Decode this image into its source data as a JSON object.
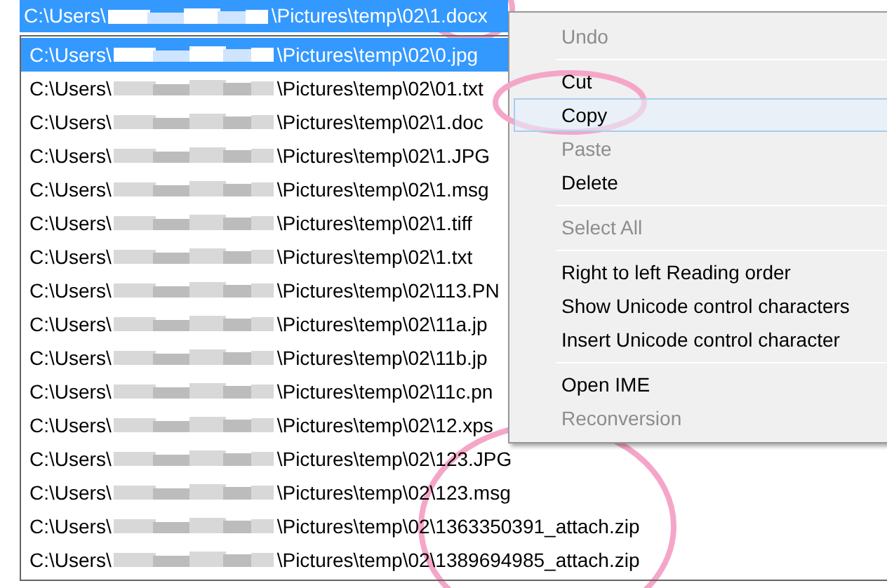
{
  "path_field": {
    "prefix": "C:\\Users\\",
    "suffix": "\\Pictures\\temp\\02\\1.docx"
  },
  "list": [
    {
      "prefix": "C:\\Users\\",
      "suffix": "\\Pictures\\temp\\02\\0.jpg",
      "selected": true
    },
    {
      "prefix": "C:\\Users\\",
      "suffix": "\\Pictures\\temp\\02\\01.txt",
      "selected": false
    },
    {
      "prefix": "C:\\Users\\",
      "suffix": "\\Pictures\\temp\\02\\1.doc",
      "selected": false
    },
    {
      "prefix": "C:\\Users\\",
      "suffix": "\\Pictures\\temp\\02\\1.JPG",
      "selected": false
    },
    {
      "prefix": "C:\\Users\\",
      "suffix": "\\Pictures\\temp\\02\\1.msg",
      "selected": false
    },
    {
      "prefix": "C:\\Users\\",
      "suffix": "\\Pictures\\temp\\02\\1.tiff",
      "selected": false
    },
    {
      "prefix": "C:\\Users\\",
      "suffix": "\\Pictures\\temp\\02\\1.txt",
      "selected": false
    },
    {
      "prefix": "C:\\Users\\",
      "suffix": "\\Pictures\\temp\\02\\113.PN",
      "selected": false
    },
    {
      "prefix": "C:\\Users\\",
      "suffix": "\\Pictures\\temp\\02\\11a.jp",
      "selected": false
    },
    {
      "prefix": "C:\\Users\\",
      "suffix": "\\Pictures\\temp\\02\\11b.jp",
      "selected": false
    },
    {
      "prefix": "C:\\Users\\",
      "suffix": "\\Pictures\\temp\\02\\11c.pn",
      "selected": false
    },
    {
      "prefix": "C:\\Users\\",
      "suffix": "\\Pictures\\temp\\02\\12.xps",
      "selected": false
    },
    {
      "prefix": "C:\\Users\\",
      "suffix": "\\Pictures\\temp\\02\\123.JPG",
      "selected": false
    },
    {
      "prefix": "C:\\Users\\",
      "suffix": "\\Pictures\\temp\\02\\123.msg",
      "selected": false
    },
    {
      "prefix": "C:\\Users\\",
      "suffix": "\\Pictures\\temp\\02\\1363350391_attach.zip",
      "selected": false
    },
    {
      "prefix": "C:\\Users\\",
      "suffix": "\\Pictures\\temp\\02\\1389694985_attach.zip",
      "selected": false
    }
  ],
  "context_menu": [
    {
      "kind": "item",
      "label": "Undo",
      "disabled": true,
      "selected": false
    },
    {
      "kind": "separator"
    },
    {
      "kind": "item",
      "label": "Cut",
      "disabled": false,
      "selected": false
    },
    {
      "kind": "item",
      "label": "Copy",
      "disabled": false,
      "selected": true
    },
    {
      "kind": "item",
      "label": "Paste",
      "disabled": true,
      "selected": false
    },
    {
      "kind": "item",
      "label": "Delete",
      "disabled": false,
      "selected": false
    },
    {
      "kind": "separator"
    },
    {
      "kind": "item",
      "label": "Select All",
      "disabled": true,
      "selected": false
    },
    {
      "kind": "separator"
    },
    {
      "kind": "item",
      "label": "Right to left Reading order",
      "disabled": false,
      "selected": false
    },
    {
      "kind": "item",
      "label": "Show Unicode control characters",
      "disabled": false,
      "selected": false
    },
    {
      "kind": "item",
      "label": "Insert Unicode control character",
      "disabled": false,
      "selected": false
    },
    {
      "kind": "separator"
    },
    {
      "kind": "item",
      "label": "Open IME",
      "disabled": false,
      "selected": false
    },
    {
      "kind": "item",
      "label": "Reconversion",
      "disabled": true,
      "selected": false
    }
  ]
}
